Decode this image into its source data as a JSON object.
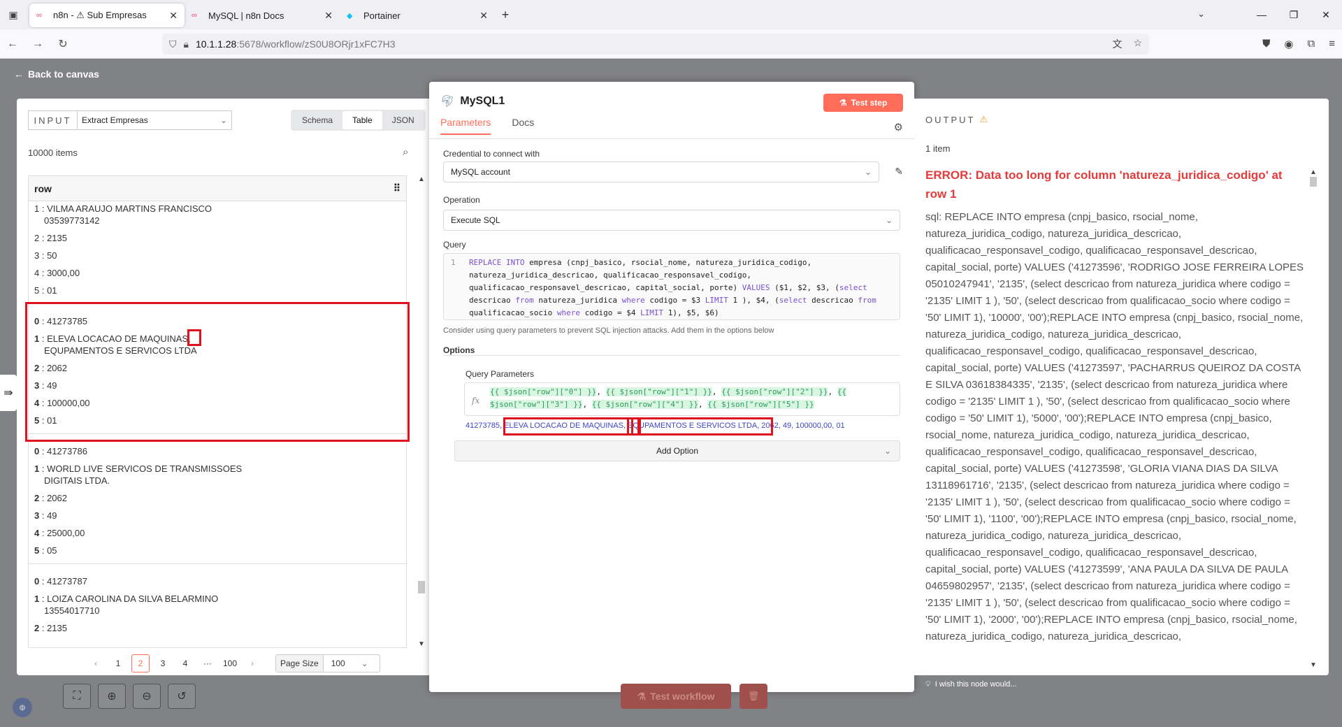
{
  "browser": {
    "tabs": [
      {
        "title": "n8n - ⚠ Sub Empresas",
        "active": true
      },
      {
        "title": "MySQL | n8n Docs",
        "active": false
      },
      {
        "title": "Portainer",
        "active": false
      }
    ],
    "url_host": "10.1.1.28",
    "url_rest": ":5678/workflow/zS0U8ORjr1xFC7H3"
  },
  "n8n": {
    "back_label": "Back to canvas",
    "test_workflow_label": "Test workflow",
    "feedback_label": "I wish this node would..."
  },
  "input": {
    "label": "INPUT",
    "source": "Extract Empresas",
    "view_tabs": [
      "Schema",
      "Table",
      "JSON"
    ],
    "active_view": "Table",
    "items_count": "10000 items",
    "column": "row",
    "partial_row": {
      "line1": "1 : VILMA ARAUJO MARTINS FRANCISCO",
      "line1b": "03539773142",
      "v2": "2 : 2135",
      "v3": "3 : 50",
      "v4": "4 : 3000,00",
      "v5": "5 : 01"
    },
    "rows": [
      {
        "k0": "0",
        "v0": "41273785",
        "k1": "1",
        "v1": "ELEVA LOCACAO DE MAQUINAS,",
        "v1b": "EQUPAMENTOS E SERVICOS LTDA",
        "k2": "2",
        "v2": "2062",
        "k3": "3",
        "v3": "49",
        "k4": "4",
        "v4": "100000,00",
        "k5": "5",
        "v5": "01"
      },
      {
        "k0": "0",
        "v0": "41273786",
        "k1": "1",
        "v1": "WORLD LIVE SERVICOS DE TRANSMISSOES",
        "v1b": "DIGITAIS LTDA.",
        "k2": "2",
        "v2": "2062",
        "k3": "3",
        "v3": "49",
        "k4": "4",
        "v4": "25000,00",
        "k5": "5",
        "v5": "05"
      },
      {
        "k0": "0",
        "v0": "41273787",
        "k1": "1",
        "v1": "LOIZA CAROLINA DA SILVA BELARMINO",
        "v1b": "13554017710",
        "k2": "2",
        "v2": "2135"
      }
    ],
    "pager": {
      "pages": [
        "1",
        "2",
        "3",
        "4",
        "···",
        "100"
      ],
      "current": "2",
      "page_size_label": "Page Size",
      "page_size": "100"
    }
  },
  "node": {
    "title": "MySQL1",
    "test_step": "Test step",
    "tabs": [
      "Parameters",
      "Docs"
    ],
    "credential_label": "Credential to connect with",
    "credential": "MySQL account",
    "operation_label": "Operation",
    "operation": "Execute SQL",
    "query_label": "Query",
    "query_line_no": "1",
    "query_hint": "Consider using query parameters to prevent SQL injection attacks. Add them in the options below",
    "options_label": "Options",
    "query_params_label": "Query Parameters",
    "expr_result": {
      "a": "41273785",
      "b": "ELEVA LOCACAO DE MAQUINAS",
      "c": ", E",
      "d": "QUPAMENTOS E SERVICOS LTDA",
      "e": ", 2062, 49, 100000,00, 01"
    },
    "add_option": "Add Option"
  },
  "output": {
    "label": "OUTPUT",
    "count": "1 item",
    "error": "ERROR: Data too long for column 'natureza_juridica_codigo' at row 1",
    "sql": "sql: REPLACE INTO empresa (cnpj_basico, rsocial_nome, natureza_juridica_codigo, natureza_juridica_descricao, qualificacao_responsavel_codigo, qualificacao_responsavel_descricao, capital_social, porte) VALUES ('41273596', 'RODRIGO JOSE FERREIRA LOPES 05010247941', '2135', (select descricao from natureza_juridica where codigo = '2135' LIMIT 1 ), '50', (select descricao from qualificacao_socio where codigo = '50' LIMIT 1), '10000', '00');REPLACE INTO empresa (cnpj_basico, rsocial_nome, natureza_juridica_codigo, natureza_juridica_descricao, qualificacao_responsavel_codigo, qualificacao_responsavel_descricao, capital_social, porte) VALUES ('41273597', 'PACHARRUS QUEIROZ DA COSTA E SILVA 03618384335', '2135', (select descricao from natureza_juridica where codigo = '2135' LIMIT 1 ), '50', (select descricao from qualificacao_socio where codigo = '50' LIMIT 1), '5000', '00');REPLACE INTO empresa (cnpj_basico, rsocial_nome, natureza_juridica_codigo, natureza_juridica_descricao, qualificacao_responsavel_codigo, qualificacao_responsavel_descricao, capital_social, porte) VALUES ('41273598', 'GLORIA VIANA DIAS DA SILVA 13118961716', '2135', (select descricao from natureza_juridica where codigo = '2135' LIMIT 1 ), '50', (select descricao from qualificacao_socio where codigo = '50' LIMIT 1), '1100', '00');REPLACE INTO empresa (cnpj_basico, rsocial_nome, natureza_juridica_codigo, natureza_juridica_descricao, qualificacao_responsavel_codigo, qualificacao_responsavel_descricao, capital_social, porte) VALUES ('41273599', 'ANA PAULA DA SILVA DE PAULA 04659802957', '2135', (select descricao from natureza_juridica where codigo = '2135' LIMIT 1 ), '50', (select descricao from qualificacao_socio where codigo = '50' LIMIT 1), '2000', '00');REPLACE INTO empresa (cnpj_basico, rsocial_nome, natureza_juridica_codigo, natureza_juridica_descricao,"
  }
}
